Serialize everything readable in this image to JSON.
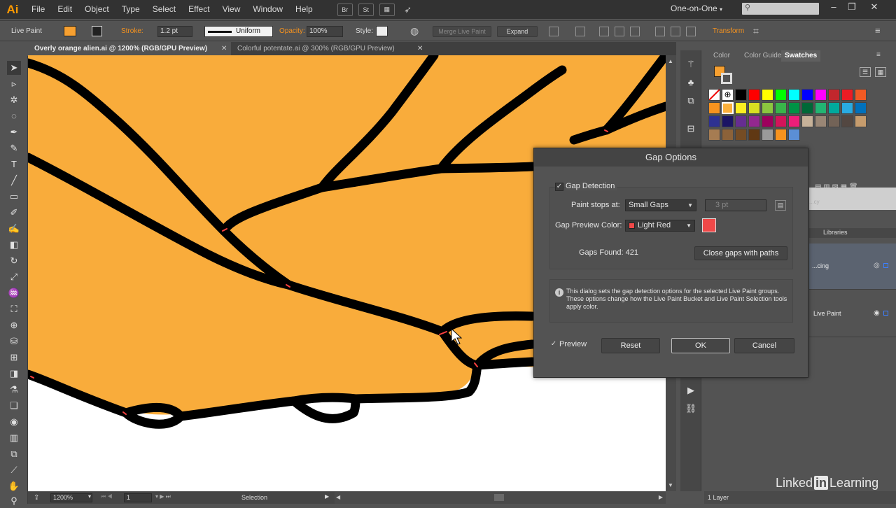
{
  "app": {
    "logo": "Ai",
    "workspace": "One-on-One"
  },
  "menu": [
    "File",
    "Edit",
    "Object",
    "Type",
    "Select",
    "Effect",
    "View",
    "Window",
    "Help"
  ],
  "menu_icons": [
    "Br",
    "St"
  ],
  "control_bar": {
    "mode_label": "Live Paint",
    "stroke_label": "Stroke:",
    "stroke_value": "1.2 pt",
    "profile": "Uniform",
    "opacity_label": "Opacity:",
    "opacity_value": "100%",
    "style_label": "Style:",
    "merge_button": "Merge Live Paint",
    "expand_button": "Expand",
    "transform_label": "Transform",
    "fill_color": "#f7a030"
  },
  "tabs": [
    {
      "label": "Overly orange alien.ai @ 1200% (RGB/GPU Preview)",
      "active": true
    },
    {
      "label": "Colorful potentate.ai @ 300% (RGB/GPU Preview)",
      "active": false
    }
  ],
  "status_bar": {
    "zoom": "1200%",
    "artboard": "1",
    "tool": "Selection"
  },
  "swatches_panel": {
    "tabs": [
      "Color",
      "Color Guide",
      "Swatches"
    ],
    "active_tab": "Swatches",
    "swatch_rows": [
      [
        "#ffffff",
        "#ffffff",
        "#000000",
        "#ff0000",
        "#ffff00",
        "#00ff00",
        "#00ffff",
        "#0000ff",
        "#ff00ff",
        "#c1272d",
        "#ed1c24",
        "#f15a24"
      ],
      [
        "#f7931e",
        "#fbb03b",
        "#fcee21",
        "#d9e021",
        "#8cc63f",
        "#39b54a",
        "#009245",
        "#006837",
        "#22b573",
        "#00a99d",
        "#29abe2",
        "#0071bc"
      ],
      [
        "#2e3192",
        "#1b1464",
        "#662d91",
        "#93278f",
        "#9e005d",
        "#d4145a",
        "#ed1e79",
        "#c7b299",
        "#998675",
        "#736357",
        "#534741",
        "#c69c6d"
      ],
      [
        "#a67c52",
        "#8c6239",
        "#754c24",
        "#603813",
        "#9a9a9a",
        "#f7931e",
        "#5b8fd6"
      ]
    ]
  },
  "right_panels": {
    "libraries_tab": "Libraries",
    "layer_rows": [
      "...cing",
      "Live Paint"
    ],
    "layers_footer": "1 Layer"
  },
  "dialog": {
    "title": "Gap Options",
    "gap_detection_label": "Gap Detection",
    "gap_detection_checked": true,
    "paint_stops_label": "Paint stops at:",
    "paint_stops_value": "Small Gaps",
    "custom_gap_value": "3 pt",
    "preview_color_label": "Gap Preview Color:",
    "preview_color_value": "Light Red",
    "preview_color_hex": "#f04848",
    "gaps_found_label": "Gaps Found: 421",
    "close_gaps_button": "Close gaps with paths",
    "info_text": "This dialog sets the gap detection options for the selected Live Paint groups. These options change how the Live Paint Bucket and Live Paint Selection tools apply color.",
    "preview_label": "Preview",
    "preview_checked": true,
    "reset_button": "Reset",
    "ok_button": "OK",
    "cancel_button": "Cancel"
  },
  "artwork": {
    "fill_color": "#f9ac3b",
    "stroke_color": "#000000",
    "gap_marker_color": "#ff4040"
  },
  "watermark": {
    "brand_left": "Linked",
    "brand_in": "in",
    "brand_right": "Learning"
  }
}
